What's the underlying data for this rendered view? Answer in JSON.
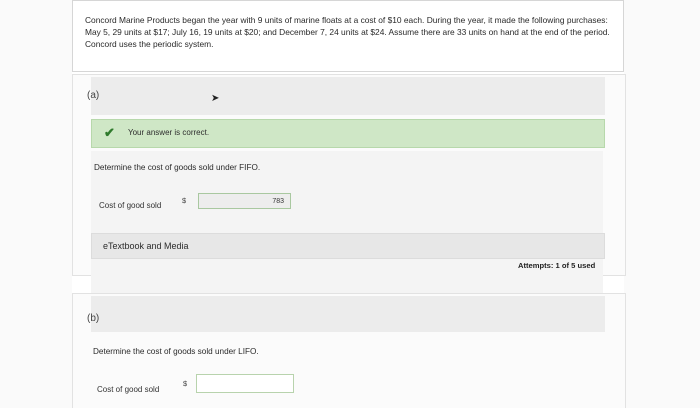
{
  "problem": {
    "text": "Concord Marine Products began the year with 9 units of marine floats at a cost of $10 each. During the year, it made the following purchases: May 5, 29 units at $17; July 16, 19 units at $20; and December 7, 24 units at $24. Assume there are 33 units on hand at the end of the period. Concord uses the periodic system."
  },
  "part_a": {
    "label": "(a)",
    "correct_text": "Your answer is correct.",
    "question": "Determine the cost of goods sold under FIFO.",
    "row_label": "Cost of good sold",
    "currency": "$",
    "answer_value": "783",
    "etext_label": "eTextbook and Media",
    "attempts": "Attempts: 1 of 5 used"
  },
  "part_b": {
    "label": "(b)",
    "question": "Determine the cost of goods sold under LIFO.",
    "row_label": "Cost of good sold",
    "currency": "$",
    "answer_value": ""
  }
}
